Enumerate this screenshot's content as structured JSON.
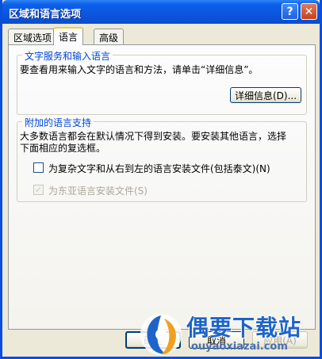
{
  "window": {
    "title": "区域和语言选项"
  },
  "tabs": [
    {
      "label": "区域选项"
    },
    {
      "label": "语言"
    },
    {
      "label": "高级"
    }
  ],
  "text_services": {
    "legend": "文字服务和输入语言",
    "description": "要查看用来输入文字的语言和方法，请单击“详细信息”。",
    "details_button": "详细信息(D)..."
  },
  "supplemental": {
    "legend": "附加的语言支持",
    "description_line1": "大多数语言都会在默认情况下得到安装。要安装其他语言，选择",
    "description_line2": "下面相应的复选框。",
    "complex_script_label": "为复杂文字和从右到左的语言安装文件(包括泰文)(N)",
    "complex_script_checked": false,
    "east_asian_label": "为东亚语言安装文件(S)",
    "east_asian_checked": true
  },
  "buttons": {
    "ok": "确定",
    "cancel": "取消",
    "apply": "应用(A)"
  },
  "watermark": {
    "title": "偶要下载站",
    "url": "ouyaoxiazai.com"
  }
}
